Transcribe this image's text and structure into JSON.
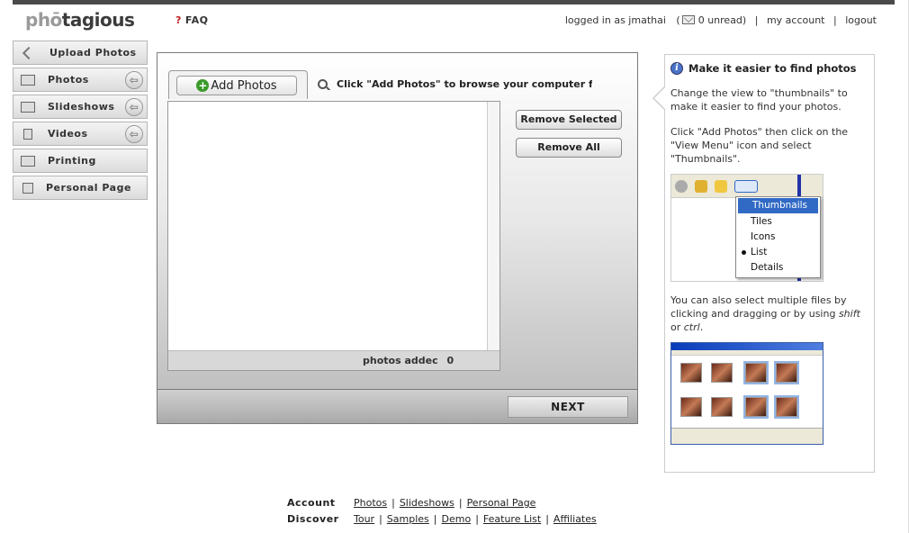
{
  "header": {
    "logo_part1": "phō",
    "logo_part2": "tagious",
    "faq_icon": "?",
    "faq_label": "FAQ",
    "logged_in_text": "logged in as jmathai",
    "unread_text": "0 unread)",
    "unread_open": "(",
    "my_account_label": "my account",
    "logout_label": "logout",
    "separator": "|"
  },
  "sidebar": {
    "items": [
      {
        "label": "Upload Photos",
        "icon": "upload-arrow-icon",
        "has_arrow": false
      },
      {
        "label": "Photos",
        "icon": "camera-icon",
        "has_arrow": true
      },
      {
        "label": "Slideshows",
        "icon": "slideshow-icon",
        "has_arrow": true
      },
      {
        "label": "Videos",
        "icon": "film-icon",
        "has_arrow": true
      },
      {
        "label": "Printing",
        "icon": "printer-icon",
        "has_arrow": false
      },
      {
        "label": "Personal Page",
        "icon": "page-icon",
        "has_arrow": false
      }
    ],
    "arrow_glyph": "⇦"
  },
  "uploader": {
    "add_photos_label": "Add Photos",
    "add_icon": "+",
    "hint_text": "Click \"Add Photos\" to browse your computer for fil",
    "photos_added_label": "photos addec",
    "photos_added_count": "0",
    "remove_selected_label": "Remove Selected",
    "remove_all_label": "Remove All",
    "next_label": "NEXT"
  },
  "help": {
    "title": "Make it easier to find photos",
    "info_icon": "i",
    "para1": "Change the view to \"thumbnails\" to make it easier to find your photos.",
    "para2": "Click \"Add Photos\" then click on the \"View Menu\" icon and select \"Thumbnails\".",
    "menu_items": [
      "Thumbnails",
      "Tiles",
      "Icons",
      "List",
      "Details"
    ],
    "para3_a": "You can also select multiple files by clicking and dragging or by using ",
    "para3_shift": "shift",
    "para3_b": " or ",
    "para3_ctrl": "ctrl",
    "para3_c": "."
  },
  "footer": {
    "rows": [
      {
        "label": "Account",
        "links": [
          "Photos",
          "Slideshows",
          "Personal Page"
        ]
      },
      {
        "label": "Discover",
        "links": [
          "Tour",
          "Samples",
          "Demo",
          "Feature List",
          "Affiliates"
        ]
      }
    ]
  },
  "colors": {
    "accent_blue": "#316ac5",
    "plus_green": "#3a9a2a",
    "topbar": "#4a4a4a"
  }
}
